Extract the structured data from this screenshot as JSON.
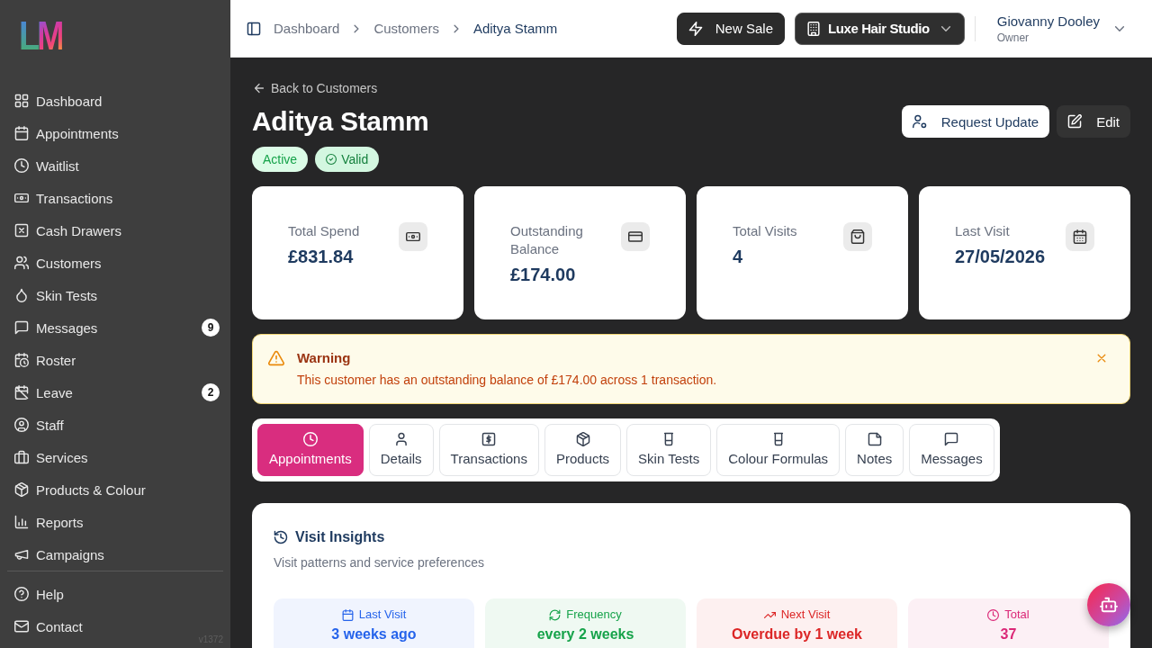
{
  "sidebar": {
    "logo": "LM",
    "items": [
      {
        "label": "Dashboard"
      },
      {
        "label": "Appointments"
      },
      {
        "label": "Waitlist"
      },
      {
        "label": "Transactions"
      },
      {
        "label": "Cash Drawers"
      },
      {
        "label": "Customers"
      },
      {
        "label": "Skin Tests"
      },
      {
        "label": "Messages",
        "badge": "9"
      },
      {
        "label": "Roster"
      },
      {
        "label": "Leave",
        "badge": "2"
      },
      {
        "label": "Staff"
      },
      {
        "label": "Services"
      },
      {
        "label": "Products & Colour"
      },
      {
        "label": "Reports"
      },
      {
        "label": "Campaigns"
      }
    ],
    "footer_items": [
      {
        "label": "Help"
      },
      {
        "label": "Contact"
      }
    ],
    "version": "v1372"
  },
  "topbar": {
    "breadcrumbs": [
      {
        "label": "Dashboard",
        "current": false
      },
      {
        "label": "Customers",
        "current": false
      },
      {
        "label": "Aditya Stamm",
        "current": true
      }
    ],
    "new_sale": "New Sale",
    "location": "Luxe Hair Studio",
    "user": {
      "name": "Giovanny Dooley",
      "role": "Owner"
    }
  },
  "customer": {
    "back_link": "Back to Customers",
    "name": "Aditya Stamm",
    "badges": [
      {
        "label": "Active",
        "kind": "plain"
      },
      {
        "label": "Valid",
        "kind": "verified"
      }
    ],
    "actions": [
      {
        "label": "Request Update",
        "kind": "light"
      },
      {
        "label": "Edit",
        "kind": "dark"
      }
    ]
  },
  "stats": [
    {
      "label": "Total Spend",
      "value": "£831.84"
    },
    {
      "label": "Outstanding Balance",
      "value": "£174.00"
    },
    {
      "label": "Total Visits",
      "value": "4"
    },
    {
      "label": "Last Visit",
      "value": "27/05/2026"
    }
  ],
  "alert": {
    "title": "Warning",
    "message": "This customer has an outstanding balance of £174.00 across 1 transaction."
  },
  "tabs": [
    {
      "label": "Appointments",
      "selected": true
    },
    {
      "label": "Details",
      "selected": false
    },
    {
      "label": "Transactions",
      "selected": false
    },
    {
      "label": "Products",
      "selected": false
    },
    {
      "label": "Skin Tests",
      "selected": false
    },
    {
      "label": "Colour Formulas",
      "selected": false
    },
    {
      "label": "Notes",
      "selected": false
    },
    {
      "label": "Messages",
      "selected": false
    }
  ],
  "insights": {
    "title": "Visit Insights",
    "subtitle": "Visit patterns and service preferences",
    "items": [
      {
        "label": "Last Visit",
        "value": "3 weeks ago",
        "color": "#2563eb"
      },
      {
        "label": "Frequency",
        "value": "every 2 weeks",
        "color": "#16a34a"
      },
      {
        "label": "Next Visit",
        "value": "Overdue by 1 week",
        "color": "#dc2626"
      },
      {
        "label": "Total",
        "value": "37",
        "color": "#db2777"
      }
    ]
  }
}
